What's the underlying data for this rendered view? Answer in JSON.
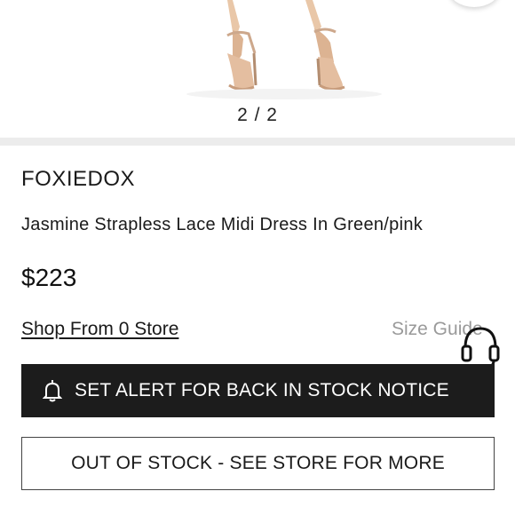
{
  "gallery": {
    "counter": "2 / 2"
  },
  "product": {
    "brand": "FOXIEDOX",
    "title": "Jasmine Strapless Lace Midi Dress In Green/pink",
    "price": "$223"
  },
  "links": {
    "shop_from": "Shop From 0 Store",
    "size_guide": "Size Guide"
  },
  "buttons": {
    "set_alert": "SET ALERT FOR BACK IN STOCK NOTICE",
    "out_of_stock": "OUT OF STOCK - SEE STORE FOR MORE"
  },
  "icons": {
    "bell": "bell-icon",
    "headset": "headset-icon"
  },
  "colors": {
    "primary_button": "#1c1c1c",
    "muted_text": "#9a9a9a",
    "divider": "#ececec"
  }
}
